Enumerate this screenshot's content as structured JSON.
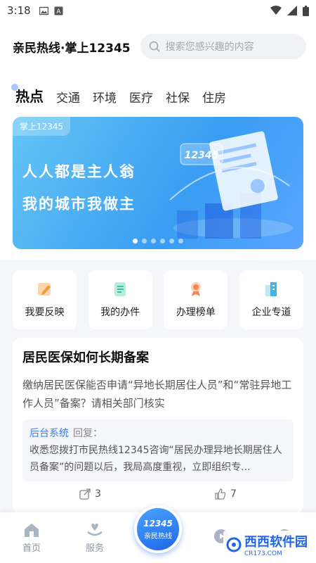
{
  "status_bar": {
    "time": "3:18"
  },
  "header": {
    "app_title": "亲民热线·掌上12345",
    "search_placeholder": "搜索您感兴趣的内容"
  },
  "tabs": [
    "热点",
    "交通",
    "环境",
    "医疗",
    "社保",
    "住房"
  ],
  "banner": {
    "tag": "掌上12345",
    "line1": "人人都是主人翁",
    "line2": "我的城市我做主",
    "art_text": "12345",
    "page_count": 6,
    "active_page": 1
  },
  "quick_actions": [
    {
      "label": "我要反映",
      "icon": "edit-icon",
      "color": "#f29b38"
    },
    {
      "label": "我的办件",
      "icon": "document-icon",
      "color": "#38c2a0"
    },
    {
      "label": "办理榜单",
      "icon": "trophy-icon",
      "color": "#f08a55"
    },
    {
      "label": "企业专道",
      "icon": "building-icon",
      "color": "#3fb6e6"
    }
  ],
  "article": {
    "title": "居民医保如何长期备案",
    "body": "缴纳居民医保能否申请“异地长期居住人员”和“常驻异地工作人员”备案？请相关部门核实",
    "reply_from": "后台系统",
    "reply_label": "回复：",
    "reply_text": "收悉您拨打市民热线12345咨询“居民办理异地长期居住人员备案”的问题以后，我局高度重视，立即组织专...",
    "share_count": "3",
    "like_count": "7"
  },
  "bottom_nav": {
    "home": "首页",
    "service": "服务",
    "hotline_number": "12345",
    "hotline_label": "亲民热线"
  },
  "watermark": {
    "text": "西西软件园",
    "sub": "CR173.COM"
  },
  "colors": {
    "primary": "#1f66e6",
    "banner_start": "#63c6f4",
    "banner_end": "#3a9df2"
  }
}
